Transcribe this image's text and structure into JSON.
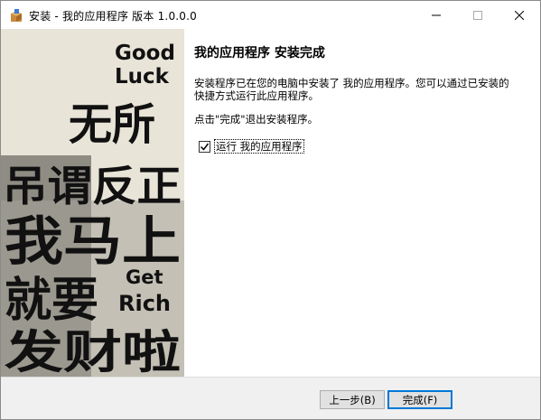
{
  "window": {
    "title": "安装 - 我的应用程序 版本 1.0.0.0",
    "app_icon": "installer-box-icon"
  },
  "banner": {
    "lines": [
      "Good",
      "Luck",
      "无所",
      "吊谓反正",
      "我马上",
      "就要",
      "Get",
      "Rich",
      "发财啦"
    ]
  },
  "main": {
    "heading": "我的应用程序 安装完成",
    "description": "安装程序已在您的电脑中安装了 我的应用程序。您可以通过已安装的快捷方式运行此应用程序。",
    "hint": "点击\"完成\"退出安装程序。",
    "checkbox": {
      "label": "运行 我的应用程序",
      "checked": true
    }
  },
  "footer": {
    "back_label": "上一步(B)",
    "finish_label": "完成(F)"
  },
  "colors": {
    "accent": "#0078d7",
    "banner_bg": "#e6e2d6",
    "banner_text": "#111111"
  }
}
